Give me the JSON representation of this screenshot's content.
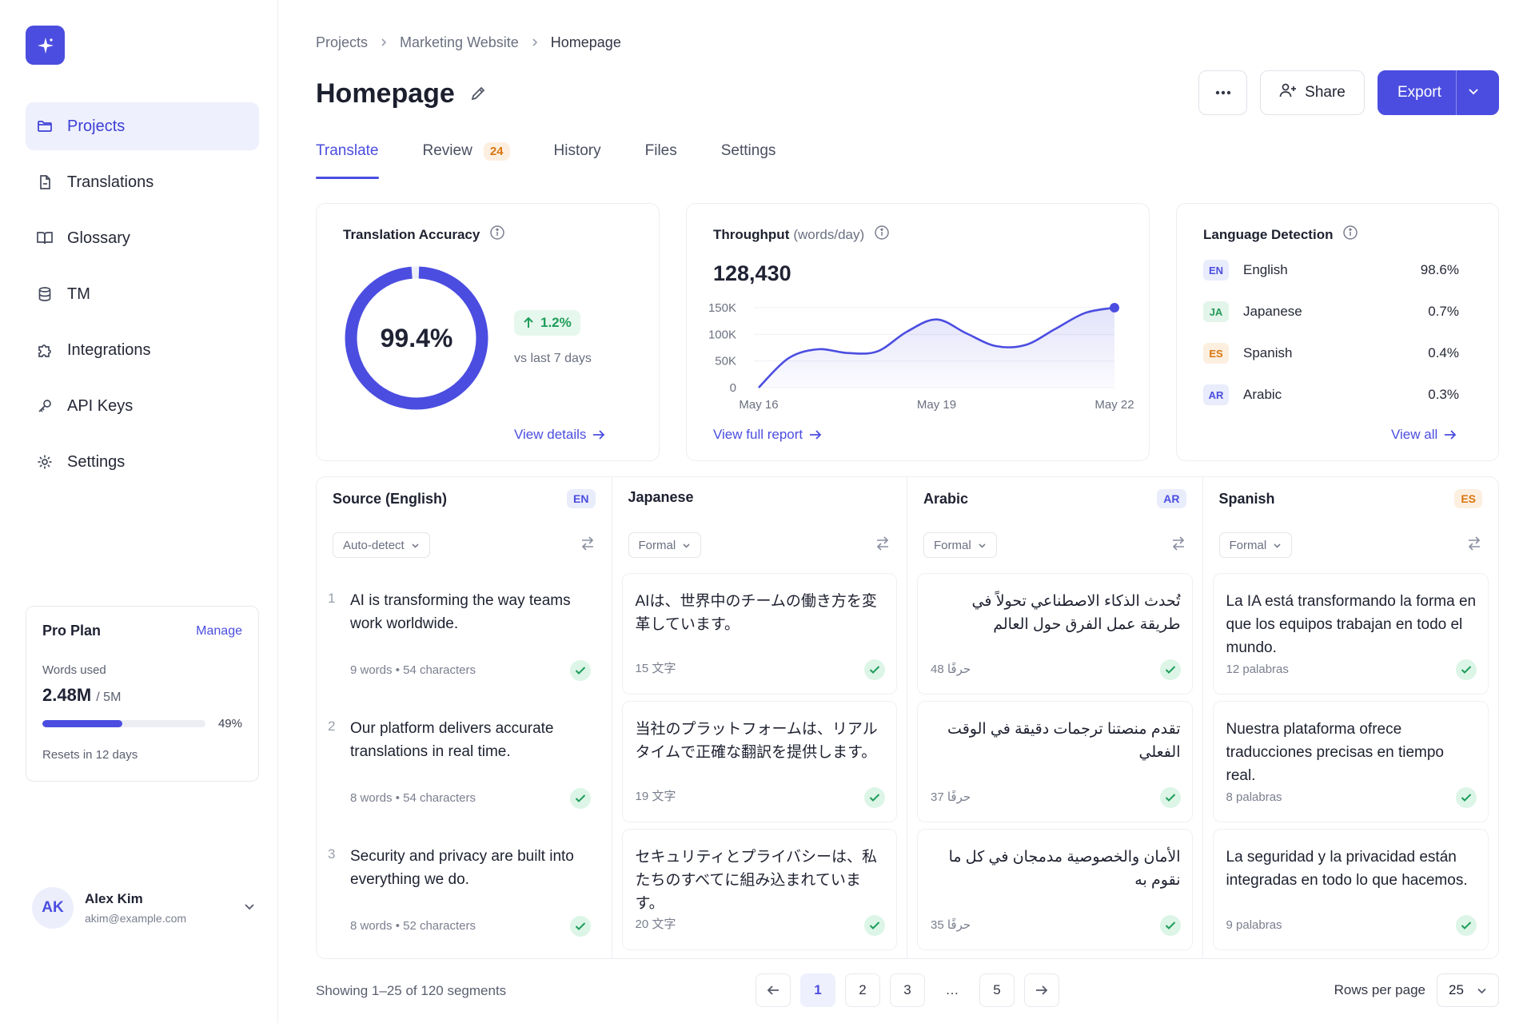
{
  "sidebar": {
    "items": [
      {
        "label": "Projects",
        "icon": "folder-icon",
        "active": true
      },
      {
        "label": "Translations",
        "icon": "file-icon",
        "active": false
      },
      {
        "label": "Glossary",
        "icon": "book-icon",
        "active": false
      },
      {
        "label": "TM",
        "icon": "database-icon",
        "active": false
      },
      {
        "label": "Integrations",
        "icon": "puzzle-icon",
        "active": false
      },
      {
        "label": "API Keys",
        "icon": "key-icon",
        "active": false
      },
      {
        "label": "Settings",
        "icon": "gear-icon",
        "active": false
      }
    ],
    "plan": {
      "title": "Pro Plan",
      "manage": "Manage",
      "words_label": "Words used",
      "used": "2.48M",
      "limit": "/ 5M",
      "percent_label": "49%",
      "percent": 0.49,
      "resets": "Resets in 12 days"
    },
    "user": {
      "initials": "AK",
      "name": "Alex Kim",
      "email": "akim@example.com"
    }
  },
  "header": {
    "breadcrumbs": [
      "Projects",
      "Marketing Website",
      "Homepage"
    ],
    "title": "Homepage",
    "share_label": "Share",
    "export_label": "Export"
  },
  "tabs": [
    {
      "label": "Translate",
      "active": true
    },
    {
      "label": "Review",
      "badge": "24"
    },
    {
      "label": "History"
    },
    {
      "label": "Files"
    },
    {
      "label": "Settings"
    }
  ],
  "accuracy": {
    "title": "Translation Accuracy",
    "value": "99.4%",
    "fraction": 0.994,
    "delta": "1.2%",
    "compare": "vs last 7 days",
    "link": "View details"
  },
  "throughput": {
    "title": "Throughput",
    "unit": "(words/day)",
    "value": "128,430",
    "link": "View full report",
    "chart_data": {
      "type": "area",
      "y_ticks": [
        "150K",
        "100K",
        "50K",
        "0"
      ],
      "ylim": [
        0,
        150000
      ],
      "x_labels": [
        "May 16",
        "May 19",
        "May 22"
      ],
      "x": [
        0,
        1,
        2,
        3,
        4,
        5,
        6,
        7,
        8,
        9,
        10,
        11,
        12
      ],
      "values": [
        0,
        55000,
        72000,
        65000,
        68000,
        105000,
        128000,
        102000,
        78000,
        80000,
        110000,
        140000,
        150000
      ],
      "accent": "#4b4de0"
    }
  },
  "detection": {
    "title": "Language Detection",
    "link": "View all",
    "rows": [
      {
        "code": "EN",
        "name": "English",
        "pct": "98.6%",
        "bg": "#e9ecfb",
        "fg": "#4b4de0"
      },
      {
        "code": "JA",
        "name": "Japanese",
        "pct": "0.7%",
        "bg": "#e3f5ea",
        "fg": "#239b5a"
      },
      {
        "code": "ES",
        "name": "Spanish",
        "pct": "0.4%",
        "bg": "#fdefe0",
        "fg": "#d9750f"
      },
      {
        "code": "AR",
        "name": "Arabic",
        "pct": "0.3%",
        "bg": "#e9ecfb",
        "fg": "#4b4de0"
      }
    ]
  },
  "columns": [
    {
      "name": "Source (English)",
      "code": "EN",
      "code_bg": "#e9ecfb",
      "code_fg": "#4b4de0",
      "select": "Auto-detect",
      "rtl": false,
      "segments": [
        {
          "num": "1",
          "text": "AI is transforming the way teams work worldwide.",
          "meta": "9 words • 54 characters"
        },
        {
          "num": "2",
          "text": "Our platform delivers accurate translations in real time.",
          "meta": "8 words • 54 characters"
        },
        {
          "num": "3",
          "text": "Security and privacy are built into everything we do.",
          "meta": "8 words • 52 characters"
        }
      ]
    },
    {
      "name": "Japanese",
      "code": "",
      "select": "Formal",
      "rtl": false,
      "segments": [
        {
          "text": "AIは、世界中のチームの働き方を変革しています。",
          "meta": "15 文字"
        },
        {
          "text": "当社のプラットフォームは、リアルタイムで正確な翻訳を提供します。",
          "meta": "19 文字"
        },
        {
          "text": "セキュリティとプライバシーは、私たちのすべてに組み込まれています。",
          "meta": "20 文字"
        }
      ]
    },
    {
      "name": "Arabic",
      "code": "AR",
      "code_bg": "#e9ecfb",
      "code_fg": "#4b4de0",
      "select": "Formal",
      "rtl": true,
      "segments": [
        {
          "text": "تُحدث الذكاء الاصطناعي تحولاً في طريقة عمل الفرق حول العالم",
          "meta": "48 حرفًا"
        },
        {
          "text": "تقدم منصتنا ترجمات دقيقة في الوقت الفعلي",
          "meta": "37 حرفًا"
        },
        {
          "text": "الأمان والخصوصية مدمجان في كل ما نقوم به",
          "meta": "35 حرفًا"
        }
      ]
    },
    {
      "name": "Spanish",
      "code": "ES",
      "code_bg": "#fdefe0",
      "code_fg": "#d9750f",
      "select": "Formal",
      "rtl": false,
      "segments": [
        {
          "text": "La IA está transformando la forma en que los equipos trabajan en todo el mundo.",
          "meta": "12 palabras"
        },
        {
          "text": "Nuestra plataforma ofrece traducciones precisas en tiempo real.",
          "meta": "8 palabras"
        },
        {
          "text": "La seguridad y la privacidad están integradas en todo lo que hacemos.",
          "meta": "9 palabras"
        }
      ]
    }
  ],
  "footer": {
    "showing": "Showing 1–25 of 120 segments",
    "pages": [
      "1",
      "2",
      "3",
      "…",
      "5"
    ],
    "rows_label": "Rows per page",
    "rows_value": "25"
  }
}
